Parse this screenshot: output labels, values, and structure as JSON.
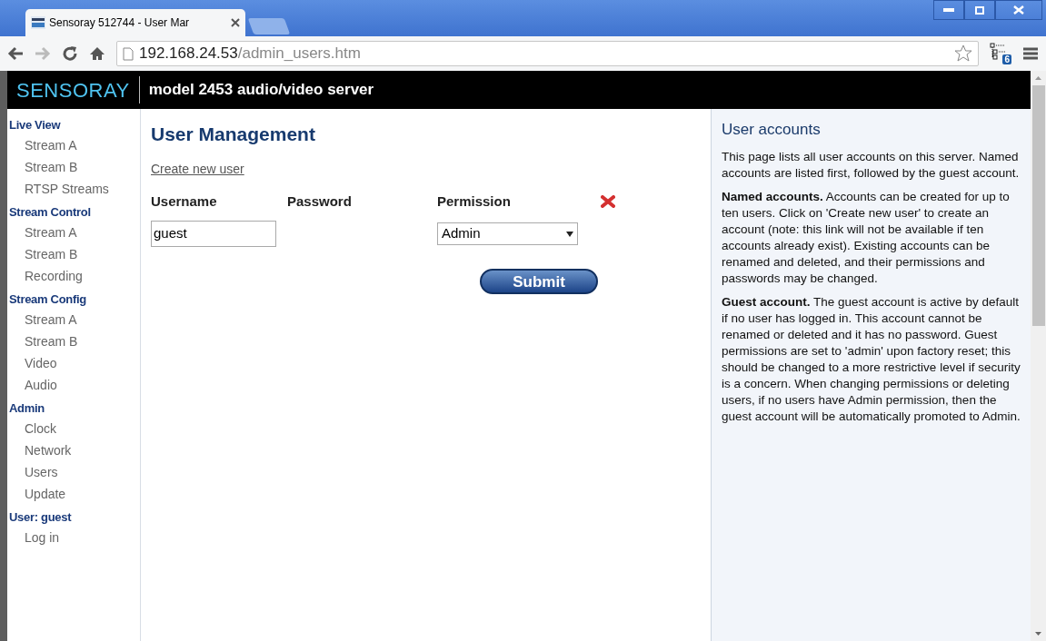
{
  "browser": {
    "tab_title": "Sensoray 512744 - User Mar",
    "address": {
      "host": "192.168.24.53",
      "path": "/admin_users.htm"
    },
    "extension_badge": "6"
  },
  "header": {
    "logo": "SENSORAY",
    "title": "model 2453 audio/video server"
  },
  "sidebar": [
    {
      "heading": "Live View",
      "items": [
        "Stream A",
        "Stream B",
        "RTSP Streams"
      ]
    },
    {
      "heading": "Stream Control",
      "items": [
        "Stream A",
        "Stream B",
        "Recording"
      ]
    },
    {
      "heading": "Stream Config",
      "items": [
        "Stream A",
        "Stream B",
        "Video",
        "Audio"
      ]
    },
    {
      "heading": "Admin",
      "items": [
        "Clock",
        "Network",
        "Users",
        "Update"
      ]
    },
    {
      "heading": "User: guest",
      "items": [
        "Log in"
      ]
    }
  ],
  "main": {
    "title": "User Management",
    "create_link": "Create new user",
    "columns": [
      "Username",
      "Password",
      "Permission"
    ],
    "users": [
      {
        "username": "guest",
        "permission": "Admin"
      }
    ],
    "submit": "Submit"
  },
  "help": {
    "title": "User accounts",
    "paragraphs": [
      "This page lists all user accounts on this server. Named accounts are listed first, followed by the guest account.",
      "**Named accounts.** Accounts can be created for up to ten users. Click on 'Create new user' to create an account (note: this link will not be available if ten accounts already exist). Existing accounts can be renamed and deleted, and their permissions and passwords may be changed.",
      "**Guest account.** The guest account is active by default if no user has logged in. This account cannot be renamed or deleted and it has no password. Guest permissions are set to 'admin' upon factory reset; this should be changed to a more restrictive level if security is a concern. When changing permissions or deleting users, if no users have Admin permission, then the guest account will be automatically promoted to Admin."
    ]
  }
}
